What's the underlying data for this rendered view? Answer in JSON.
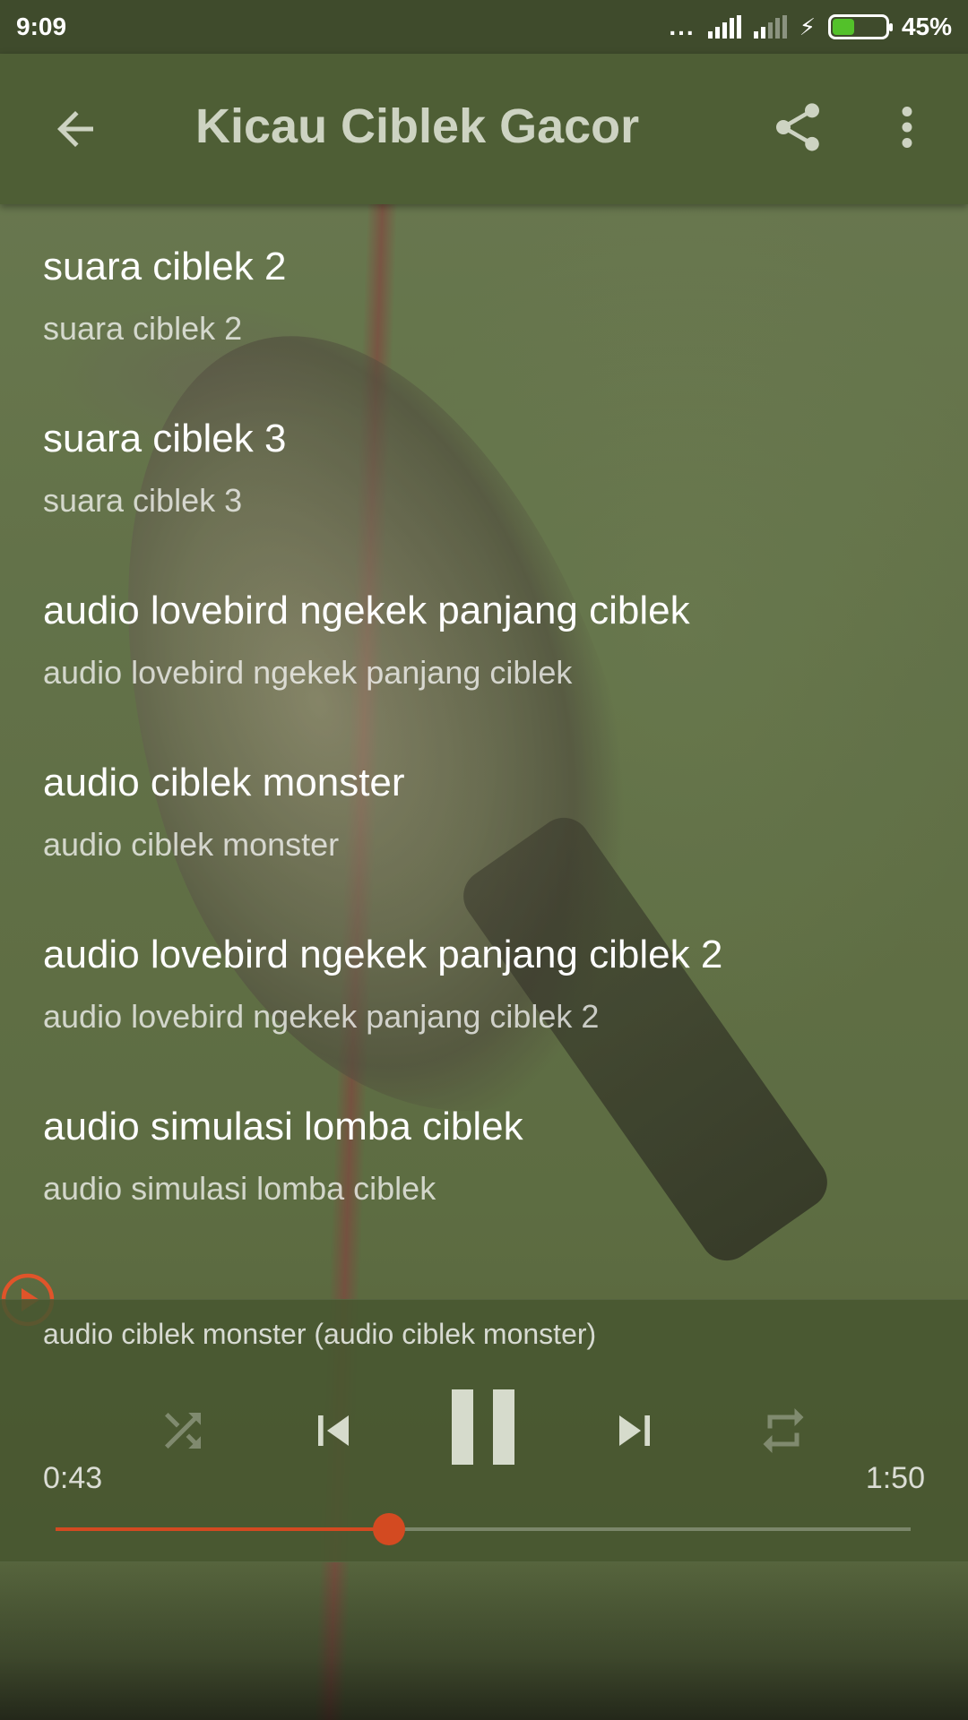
{
  "status_bar": {
    "time": "9:09",
    "dots": "...",
    "battery": "45%",
    "battery_level": 0.45,
    "battery_color": "#53c12a"
  },
  "app_bar": {
    "title": "Kicau Ciblek Gacor",
    "icons": [
      "arrow-back-icon",
      "share-icon",
      "more-vert-icon"
    ]
  },
  "tracks": [
    {
      "title": "suara ciblek 2",
      "subtitle": "suara ciblek 2"
    },
    {
      "title": "suara ciblek 3",
      "subtitle": "suara ciblek 3"
    },
    {
      "title": "audio lovebird ngekek panjang ciblek",
      "subtitle": "audio lovebird ngekek panjang ciblek"
    },
    {
      "title": "audio ciblek monster",
      "subtitle": "audio ciblek monster",
      "playing": true
    },
    {
      "title": "audio lovebird ngekek panjang ciblek 2",
      "subtitle": "audio lovebird ngekek panjang ciblek 2"
    },
    {
      "title": "audio simulasi lomba ciblek",
      "subtitle": "audio simulasi lomba ciblek"
    }
  ],
  "player": {
    "now_playing": "audio ciblek monster (audio ciblek monster)",
    "elapsed": "0:43",
    "duration": "1:50",
    "progress": 0.39,
    "accent_color": "#d34a21",
    "controls": [
      "shuffle-icon",
      "skip-previous-icon",
      "pause-icon",
      "skip-next-icon",
      "repeat-icon"
    ]
  }
}
